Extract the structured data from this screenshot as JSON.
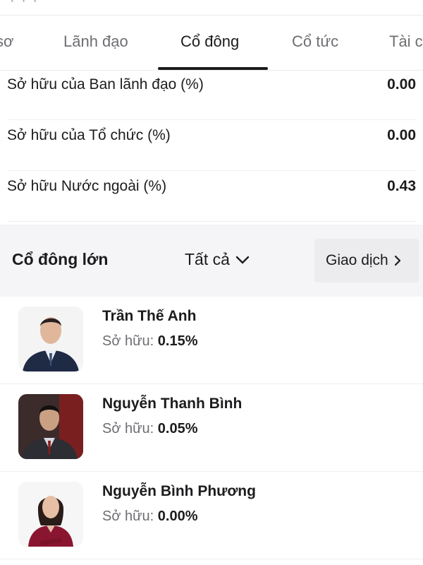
{
  "tabs": [
    {
      "label": "sơ"
    },
    {
      "label": "Lãnh đạo"
    },
    {
      "label": "Cổ đông",
      "active": true
    },
    {
      "label": "Cổ tức"
    },
    {
      "label": "Tài c"
    }
  ],
  "ownership": [
    {
      "label": "Sở hữu của Ban lãnh đạo (%)",
      "value": "0.00"
    },
    {
      "label": "Sở hữu của Tổ chức (%)",
      "value": "0.00"
    },
    {
      "label": "Sở hữu Nước ngoài (%)",
      "value": "0.43"
    }
  ],
  "major": {
    "title": "Cổ đông lớn",
    "filter_label": "Tất cả",
    "trade_label": "Giao dịch"
  },
  "shareholders": [
    {
      "name": "Trần Thế Anh",
      "own_label": "Sở hữu:",
      "own_value": "0.15%"
    },
    {
      "name": "Nguyễn Thanh Bình",
      "own_label": "Sở hữu:",
      "own_value": "0.05%"
    },
    {
      "name": "Nguyễn Bình Phương",
      "own_label": "Sở hữu:",
      "own_value": "0.00%"
    }
  ],
  "colors": {
    "text": "#1c1c1e",
    "muted": "#6e6e73",
    "section_bg": "#f5f5f7",
    "button_bg": "#ececee"
  }
}
